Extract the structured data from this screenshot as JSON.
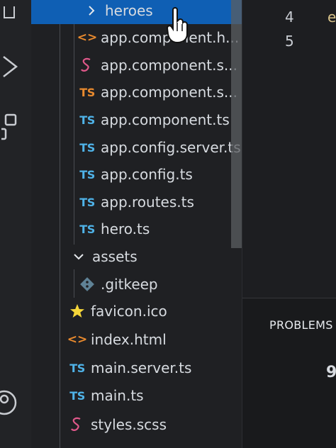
{
  "explorer": {
    "items": [
      {
        "label": "heroes",
        "icon": "chevron-right-icon",
        "glyph": "›",
        "selected": true
      },
      {
        "label": "app.component.h...",
        "icon": "html-file-icon",
        "glyph": "<>"
      },
      {
        "label": "app.component.s...",
        "icon": "scss-file-icon",
        "glyph": ""
      },
      {
        "label": "app.component.s...",
        "icon": "ts-spec-file-icon",
        "glyph": "TS"
      },
      {
        "label": "app.component.ts",
        "icon": "ts-file-icon",
        "glyph": "TS"
      },
      {
        "label": "app.config.server.ts",
        "icon": "ts-file-icon",
        "glyph": "TS"
      },
      {
        "label": "app.config.ts",
        "icon": "ts-file-icon",
        "glyph": "TS"
      },
      {
        "label": "app.routes.ts",
        "icon": "ts-file-icon",
        "glyph": "TS"
      },
      {
        "label": "hero.ts",
        "icon": "ts-file-icon",
        "glyph": "TS"
      },
      {
        "label": "assets",
        "icon": "chevron-down-icon",
        "glyph": "⌄"
      },
      {
        "label": ".gitkeep",
        "icon": "git-file-icon",
        "glyph": ""
      },
      {
        "label": "favicon.ico",
        "icon": "star-icon",
        "glyph": "★"
      },
      {
        "label": "index.html",
        "icon": "html-file-icon",
        "glyph": "<>"
      },
      {
        "label": "main.server.ts",
        "icon": "ts-file-icon",
        "glyph": "TS"
      },
      {
        "label": "main.ts",
        "icon": "ts-file-icon",
        "glyph": "TS"
      },
      {
        "label": "styles.scss",
        "icon": "scss-file-icon",
        "glyph": ""
      }
    ]
  },
  "editor": {
    "line_numbers": [
      "4",
      "5"
    ],
    "code_fragment": "e"
  },
  "panel": {
    "tab_label": "PROBLEMS",
    "fragment": "9"
  },
  "colors": {
    "selection": "#0f5fb4",
    "ts_blue": "#4fb3e8",
    "html_orange": "#e98a2e",
    "scss_pink": "#e0588a",
    "favicon_yellow": "#f5d63a"
  }
}
